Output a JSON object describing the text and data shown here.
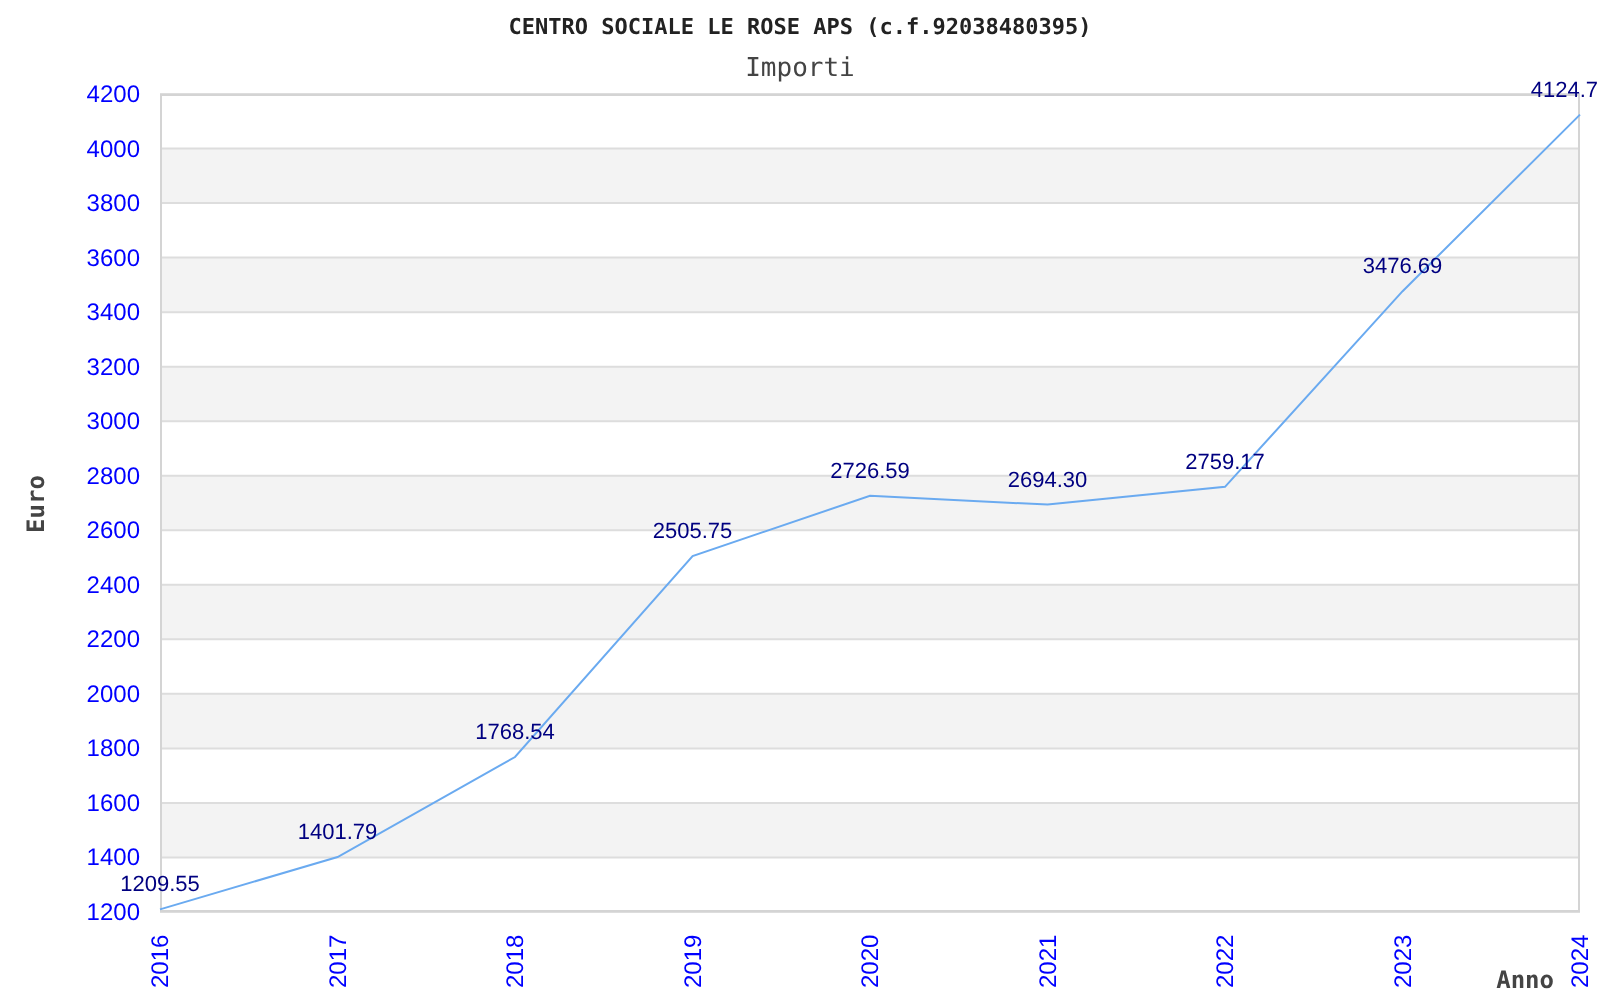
{
  "title": "CENTRO SOCIALE LE ROSE APS (c.f.92038480395)",
  "chart_data": {
    "type": "line",
    "title": "Importi",
    "xlabel": "Anno",
    "ylabel": "Euro",
    "categories": [
      "2016",
      "2017",
      "2018",
      "2019",
      "2020",
      "2021",
      "2022",
      "2023",
      "2024"
    ],
    "grid": true,
    "series": [
      {
        "color": "#6aaaf0",
        "values": [
          1209.55,
          1401.79,
          1768.54,
          2505.75,
          2726.59,
          2694.3,
          2759.17,
          3476.69,
          4124.7
        ]
      }
    ],
    "value_labels": [
      "1209.55",
      "1401.79",
      "1768.54",
      "2505.75",
      "2726.59",
      "2694.30",
      "2759.17",
      "3476.69",
      "4124.7"
    ],
    "ylim": [
      1200,
      4200
    ],
    "yticks": [
      1200,
      1400,
      1600,
      1800,
      2000,
      2200,
      2400,
      2600,
      2800,
      3000,
      3200,
      3400,
      3600,
      3800,
      4000,
      4200
    ]
  }
}
